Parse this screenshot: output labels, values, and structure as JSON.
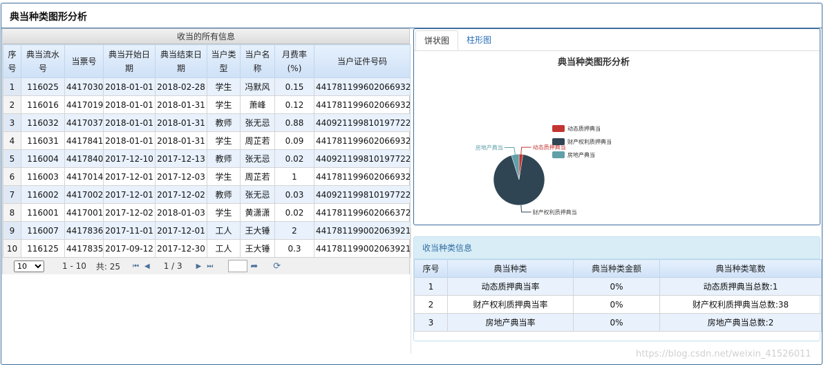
{
  "page": {
    "title": "典当种类图形分析"
  },
  "grid": {
    "caption": "收当的所有信息",
    "columns": [
      [
        "序",
        "号"
      ],
      [
        "典当流水",
        "号"
      ],
      [
        "当票号",
        ""
      ],
      [
        "典当开始日",
        "期"
      ],
      [
        "典当结束日",
        "期"
      ],
      [
        "当户类",
        "型"
      ],
      [
        "当户名",
        "称"
      ],
      [
        "月费率",
        "(%)"
      ],
      [
        "当户证件号码",
        ""
      ]
    ],
    "rows": [
      [
        "1",
        "116025",
        "4417030",
        "2018-01-01",
        "2018-02-28",
        "学生",
        "冯默风",
        "0.15",
        "441781199602066932"
      ],
      [
        "2",
        "116016",
        "4417019",
        "2018-01-01",
        "2018-01-31",
        "学生",
        "萧峰",
        "0.12",
        "441781199602066932"
      ],
      [
        "3",
        "116032",
        "4417037",
        "2018-01-01",
        "2018-01-31",
        "教师",
        "张无忌",
        "0.88",
        "440921199810197722"
      ],
      [
        "4",
        "116031",
        "4417841",
        "2018-01-01",
        "2018-01-31",
        "学生",
        "周芷若",
        "0.09",
        "441781199602066932"
      ],
      [
        "5",
        "116004",
        "4417840",
        "2017-12-10",
        "2017-12-13",
        "教师",
        "张无忌",
        "0.02",
        "440921199810197722"
      ],
      [
        "6",
        "116003",
        "4417014",
        "2017-12-01",
        "2017-12-03",
        "学生",
        "周芷若",
        "1",
        "441781199602066932"
      ],
      [
        "7",
        "116002",
        "4417002",
        "2017-12-01",
        "2017-12-02",
        "教师",
        "张无忌",
        "0.03",
        "440921199810197722"
      ],
      [
        "8",
        "116001",
        "4417001",
        "2017-12-02",
        "2018-01-03",
        "学生",
        "黄潇潇",
        "0.02",
        "441781199602066372"
      ],
      [
        "9",
        "116007",
        "4417836",
        "2017-11-01",
        "2017-12-01",
        "工人",
        "王大锤",
        "2",
        "441781199002063921"
      ],
      [
        "10",
        "116125",
        "4417835",
        "2017-09-12",
        "2017-12-30",
        "工人",
        "王大锤",
        "0.3",
        "441781199002063921"
      ]
    ]
  },
  "pager": {
    "page_size": "10",
    "range": "1 - 10",
    "total": "共: 25",
    "page_info": "1 / 3",
    "page_input": ""
  },
  "chart_tabs": [
    "饼状图",
    "柱形图"
  ],
  "chart_data": {
    "type": "pie",
    "title": "典当种类图形分析",
    "series": [
      {
        "name": "动态质押典当",
        "value": 1,
        "color": "#c23531"
      },
      {
        "name": "财产权利质押典当",
        "value": 38,
        "color": "#2f4554"
      },
      {
        "name": "房地产典当",
        "value": 2,
        "color": "#61a0a8"
      }
    ],
    "legend_position": "right",
    "slice_labels": [
      "动态质押典当",
      "财产权利质押典当",
      "房地产典当"
    ]
  },
  "summary": {
    "title": "收当种类信息",
    "columns": [
      "序号",
      "典当种类",
      "典当种类金额",
      "典当种类笔数"
    ],
    "rows": [
      [
        "1",
        "动态质押典当率",
        "0%",
        "动态质押典当总数:1"
      ],
      [
        "2",
        "财产权利质押典当率",
        "0%",
        "财产权利质押典当总数:38"
      ],
      [
        "3",
        "房地产典当率",
        "0%",
        "房地产典当总数:2"
      ]
    ]
  },
  "watermark": "https://blog.csdn.net/weixin_41526011"
}
